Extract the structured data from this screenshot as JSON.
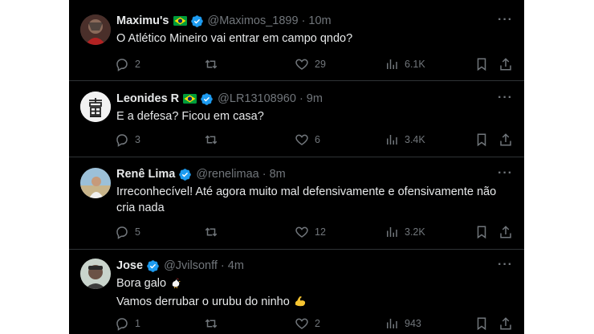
{
  "tweets": [
    {
      "name": "Maximu's",
      "handle": "@Maximos_1899",
      "time": "10m",
      "lines": [
        "O Atlético Mineiro vai entrar em campo qndo?"
      ],
      "replies": "2",
      "reposts": "",
      "likes": "29",
      "views": "6.1K",
      "has_flag": true
    },
    {
      "name": "Leonides R",
      "handle": "@LR13108960",
      "time": "9m",
      "lines": [
        "E a defesa? Ficou em casa?"
      ],
      "replies": "3",
      "reposts": "",
      "likes": "6",
      "views": "3.4K",
      "has_flag": true
    },
    {
      "name": "Renê Lima",
      "handle": "@renelimaa",
      "time": "8m",
      "lines": [
        "Irreconhecível! Até agora muito mal defensivamente e ofensivamente não",
        "cria nada"
      ],
      "replies": "5",
      "reposts": "",
      "likes": "12",
      "views": "3.2K",
      "has_flag": false
    },
    {
      "name": "Jose",
      "handle": "@Jvilsonff",
      "time": "4m",
      "lines": [
        "Bora galo",
        "Vamos derrubar o urubu do ninho"
      ],
      "replies": "1",
      "reposts": "",
      "likes": "2",
      "views": "943",
      "has_flag": false
    }
  ],
  "separator": "·",
  "more_label": "···",
  "colors": {
    "background": "#000000",
    "text": "#e7e9ea",
    "muted": "#71767b",
    "verified": "#1d9bf0",
    "divider": "#2f3336"
  },
  "icons": {
    "reply": "reply-icon",
    "repost": "repost-icon",
    "like": "heart-icon",
    "views": "views-icon",
    "bookmark": "bookmark-icon",
    "share": "share-icon",
    "more": "more-icon",
    "verified": "verified-badge-icon",
    "flag": "brazil-flag-icon"
  }
}
